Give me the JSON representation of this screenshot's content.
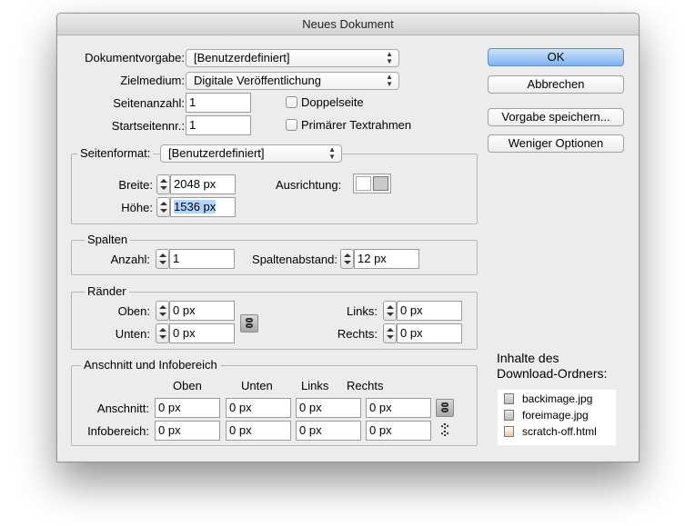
{
  "window": {
    "title": "Neues Dokument"
  },
  "top": {
    "dokumentvorgabe_label": "Dokumentvorgabe:",
    "dokumentvorgabe_value": "[Benutzerdefiniert]",
    "zielmedium_label": "Zielmedium:",
    "zielmedium_value": "Digitale Veröffentlichung",
    "seitenanzahl_label": "Seitenanzahl:",
    "seitenanzahl_value": "1",
    "startseite_label": "Startseitennr.:",
    "startseite_value": "1",
    "doppelseite_label": "Doppelseite",
    "doppelseite_checked": false,
    "textrahmen_label": "Primärer Textrahmen",
    "textrahmen_checked": false
  },
  "seitenformat": {
    "label": "Seitenformat:",
    "value": "[Benutzerdefiniert]",
    "breite_label": "Breite:",
    "breite_value": "2048 px",
    "hoehe_label": "Höhe:",
    "hoehe_value": "1536 px",
    "ausrichtung_label": "Ausrichtung:"
  },
  "spalten": {
    "title": "Spalten",
    "anzahl_label": "Anzahl:",
    "anzahl_value": "1",
    "abstand_label": "Spaltenabstand:",
    "abstand_value": "12 px"
  },
  "raender": {
    "title": "Ränder",
    "oben_label": "Oben:",
    "oben_value": "0 px",
    "unten_label": "Unten:",
    "unten_value": "0 px",
    "links_label": "Links:",
    "links_value": "0 px",
    "rechts_label": "Rechts:",
    "rechts_value": "0 px"
  },
  "anschnitt": {
    "title": "Anschnitt und Infobereich",
    "headers": [
      "Oben",
      "Unten",
      "Links",
      "Rechts"
    ],
    "anschnitt_label": "Anschnitt:",
    "anschnitt_values": [
      "0 px",
      "0 px",
      "0 px",
      "0 px"
    ],
    "infobereich_label": "Infobereich:",
    "infobereich_values": [
      "0 px",
      "0 px",
      "0 px",
      "0 px"
    ]
  },
  "buttons": {
    "ok": "OK",
    "abbrechen": "Abbrechen",
    "vorgabe": "Vorgabe speichern...",
    "weniger": "Weniger Optionen"
  },
  "download": {
    "heading_line1": "Inhalte des",
    "heading_line2": "Download-Ordners:",
    "files": [
      "backimage.jpg",
      "foreimage.jpg",
      "scratch-off.html"
    ]
  }
}
